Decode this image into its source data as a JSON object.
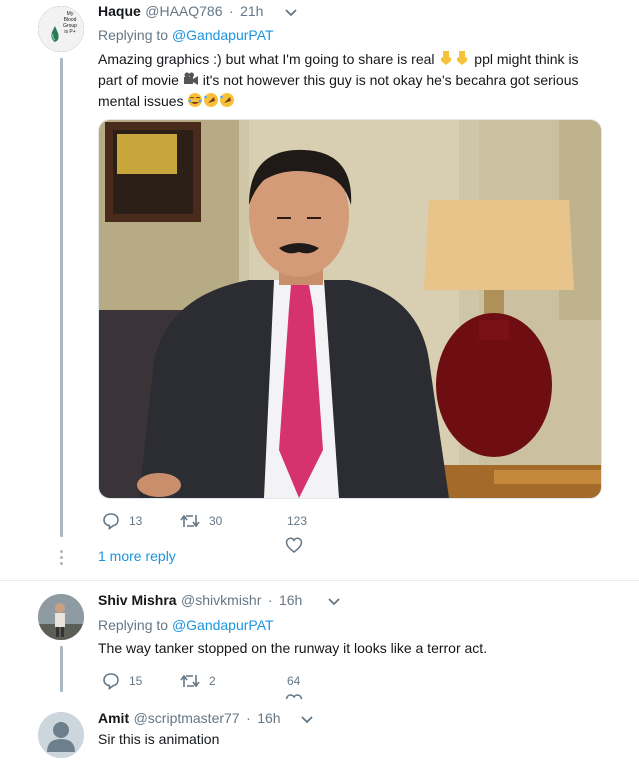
{
  "tweets": [
    {
      "author_name": "Haque",
      "author_handle": "@HAAQ786",
      "separator": "·",
      "time": "21h",
      "avatar_text": [
        "My",
        "Blood",
        "Group",
        "is P+"
      ],
      "replying_label": "Replying to",
      "replying_to": "@GandapurPAT",
      "text_line1": "Amazing graphics :) but what I'm going to share is real",
      "text_line1b": "ppl might think is",
      "text_line2a": "part of movie",
      "text_line2b": "it's not however this guy is not okay he's becahra got serious",
      "text_line3": "mental issues",
      "emojis": [
        "point-down-emoji",
        "point-down-emoji",
        "movie-camera-emoji",
        "joy-emoji",
        "rofl-emoji",
        "rofl-emoji"
      ],
      "replies": "13",
      "retweets": "30",
      "likes": "123",
      "more_replies": "1 more reply"
    },
    {
      "author_name": "Shiv Mishra",
      "author_handle": "@shivkmishr",
      "separator": "·",
      "time": "16h",
      "replying_label": "Replying to",
      "replying_to": "@GandapurPAT",
      "text": "The way tanker stopped on the runway it looks like a terror act.",
      "replies": "15",
      "retweets": "2",
      "likes": "64"
    },
    {
      "author_name": "Amit",
      "author_handle": "@scriptmaster77",
      "separator": "·",
      "time": "16h",
      "text": "Sir this is animation"
    }
  ],
  "colors": {
    "link": "#1b95e0",
    "muted": "#657786",
    "thread_line": "#aab8c2",
    "divider": "#e6ecf0",
    "tie": "#d6336c"
  }
}
